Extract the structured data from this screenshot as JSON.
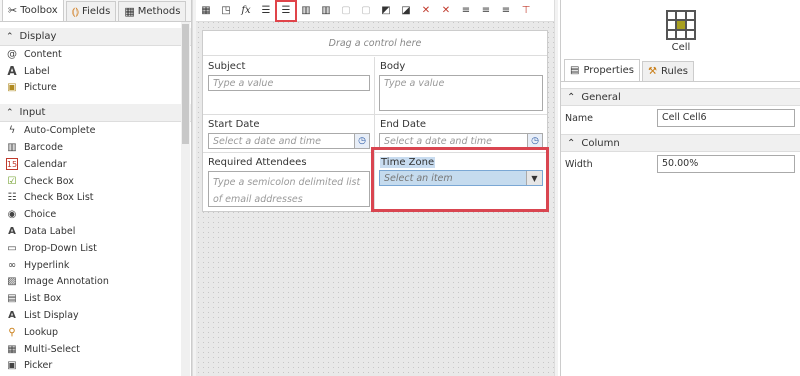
{
  "left_panel": {
    "tabs": [
      {
        "label": "Toolbox",
        "icon": "toolbox-icon",
        "active": true
      },
      {
        "label": "Fields",
        "icon": "fields-icon"
      },
      {
        "label": "Methods",
        "icon": "methods-icon"
      }
    ],
    "sections": [
      {
        "title": "Display",
        "items": [
          {
            "label": "Content",
            "icon": "at-icon"
          },
          {
            "label": "Label",
            "icon": "label-icon"
          },
          {
            "label": "Picture",
            "icon": "picture-icon"
          }
        ]
      },
      {
        "title": "Input",
        "items": [
          {
            "label": "Auto-Complete",
            "icon": "lightning-icon"
          },
          {
            "label": "Barcode",
            "icon": "barcode-icon"
          },
          {
            "label": "Calendar",
            "icon": "calendar-icon"
          },
          {
            "label": "Check Box",
            "icon": "checkbox-icon"
          },
          {
            "label": "Check Box List",
            "icon": "checkbox-list-icon"
          },
          {
            "label": "Choice",
            "icon": "choice-icon"
          },
          {
            "label": "Data Label",
            "icon": "data-label-icon"
          },
          {
            "label": "Drop-Down List",
            "icon": "dropdown-icon"
          },
          {
            "label": "Hyperlink",
            "icon": "link-icon"
          },
          {
            "label": "Image Annotation",
            "icon": "image-annotation-icon"
          },
          {
            "label": "List Box",
            "icon": "list-box-icon"
          },
          {
            "label": "List Display",
            "icon": "list-display-icon"
          },
          {
            "label": "Lookup",
            "icon": "lookup-icon"
          },
          {
            "label": "Multi-Select",
            "icon": "multi-select-icon"
          },
          {
            "label": "Picker",
            "icon": "picker-icon"
          }
        ]
      }
    ]
  },
  "canvas": {
    "dropzone_text": "Drag a control here",
    "subject": {
      "label": "Subject",
      "placeholder": "Type a value"
    },
    "body": {
      "label": "Body",
      "placeholder": "Type a value"
    },
    "start_date": {
      "label": "Start Date",
      "placeholder": "Select a date and time"
    },
    "end_date": {
      "label": "End Date",
      "placeholder": "Select a date and time"
    },
    "attendees": {
      "label": "Required Attendees",
      "placeholder": "Type a semicolon delimited list of email addresses"
    },
    "time_zone": {
      "label": "Time Zone",
      "placeholder": "Select an item"
    }
  },
  "right_panel": {
    "title": "Cell",
    "tabs": [
      {
        "label": "Properties",
        "icon": "properties-icon",
        "active": true
      },
      {
        "label": "Rules",
        "icon": "rules-icon"
      }
    ],
    "general": {
      "title": "General",
      "name_label": "Name",
      "name_value": "Cell Cell6"
    },
    "column": {
      "title": "Column",
      "width_label": "Width",
      "width_value": "50.00%"
    }
  },
  "colors": {
    "highlight": "#d94550",
    "accent": "#a8a020",
    "selection": "#c5dbee"
  }
}
